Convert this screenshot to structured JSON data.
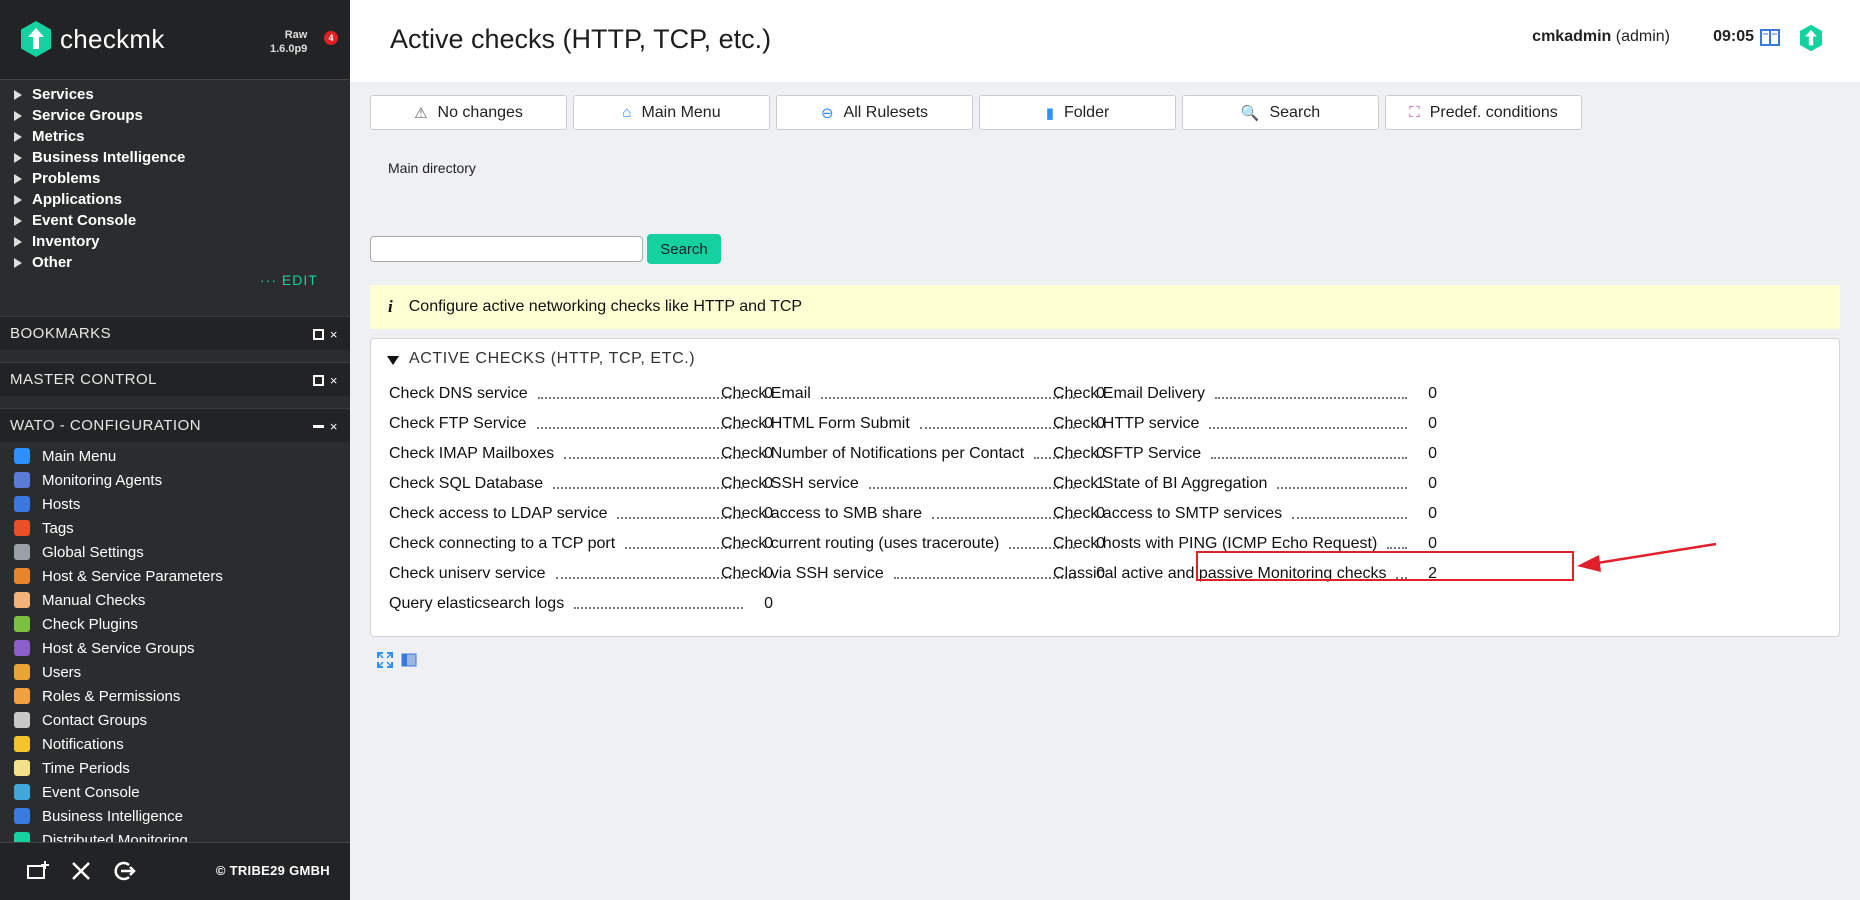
{
  "app": {
    "brand": "checkmk",
    "edition": "Raw",
    "version": "1.6.0p9",
    "werk_badge": "4",
    "copyright": "© TRIBE29 GMBH"
  },
  "colors": {
    "accent": "#15d1a0",
    "sidebar_bg": "#2a2d2e",
    "highlight": "#e0202a",
    "info_bg": "#ffffd4"
  },
  "sidebar": {
    "views": [
      {
        "label": "Services"
      },
      {
        "label": "Service Groups"
      },
      {
        "label": "Metrics"
      },
      {
        "label": "Business Intelligence"
      },
      {
        "label": "Problems"
      },
      {
        "label": "Applications"
      },
      {
        "label": "Event Console"
      },
      {
        "label": "Inventory"
      },
      {
        "label": "Other"
      }
    ],
    "edit_label": "EDIT",
    "edit_dots": "···",
    "bookmarks_title": "BOOKMARKS",
    "master_control_title": "MASTER CONTROL",
    "wato_title": "WATO - CONFIGURATION",
    "close_glyph": "×",
    "wato_items": [
      {
        "label": "Main Menu",
        "icon": "main-menu-icon",
        "color": "#2f8fff"
      },
      {
        "label": "Monitoring Agents",
        "icon": "agents-icon",
        "color": "#5a7bd6"
      },
      {
        "label": "Hosts",
        "icon": "hosts-icon",
        "color": "#3a78e0"
      },
      {
        "label": "Tags",
        "icon": "tags-icon",
        "color": "#e8502a"
      },
      {
        "label": "Global Settings",
        "icon": "settings-icon",
        "color": "#9aa0a8"
      },
      {
        "label": "Host & Service Parameters",
        "icon": "parameters-icon",
        "color": "#e8842a"
      },
      {
        "label": "Manual Checks",
        "icon": "manual-checks-icon",
        "color": "#f2b37a"
      },
      {
        "label": "Check Plugins",
        "icon": "plugins-icon",
        "color": "#7bc043"
      },
      {
        "label": "Host & Service Groups",
        "icon": "groups-icon",
        "color": "#8a5fc9"
      },
      {
        "label": "Users",
        "icon": "users-icon",
        "color": "#e8a33a"
      },
      {
        "label": "Roles & Permissions",
        "icon": "roles-icon",
        "color": "#f0a040"
      },
      {
        "label": "Contact Groups",
        "icon": "contact-groups-icon",
        "color": "#c8c8c8"
      },
      {
        "label": "Notifications",
        "icon": "bell-icon",
        "color": "#f4c430"
      },
      {
        "label": "Time Periods",
        "icon": "clock-icon",
        "color": "#f4e08a"
      },
      {
        "label": "Event Console",
        "icon": "event-console-icon",
        "color": "#40a8d8"
      },
      {
        "label": "Business Intelligence",
        "icon": "bi-icon",
        "color": "#3a7be0"
      },
      {
        "label": "Distributed Monitoring",
        "icon": "distributed-icon",
        "color": "#15d1a0"
      }
    ]
  },
  "header": {
    "title": "Active checks (HTTP, TCP, etc.)",
    "user": "cmkadmin",
    "role": "(admin)",
    "time": "09:05"
  },
  "toolbar": {
    "buttons": [
      {
        "label": "No changes",
        "icon": "warning-icon",
        "glyph": "⚠"
      },
      {
        "label": "Main Menu",
        "icon": "main-menu-icon",
        "glyph": "⌂"
      },
      {
        "label": "All Rulesets",
        "icon": "back-icon",
        "glyph": "⊖"
      },
      {
        "label": "Folder",
        "icon": "folder-icon",
        "glyph": "▮"
      },
      {
        "label": "Search",
        "icon": "search-icon",
        "glyph": "🔍"
      },
      {
        "label": "Predef. conditions",
        "icon": "conditions-icon",
        "glyph": "⛶"
      }
    ]
  },
  "breadcrumb": "Main directory",
  "search": {
    "value": "",
    "button_label": "Search"
  },
  "info": {
    "glyph": "i",
    "text": "Configure active networking checks like HTTP and TCP"
  },
  "panel": {
    "title": "ACTIVE CHECKS (HTTP, TCP, ETC.)",
    "columns": [
      [
        {
          "label": "Check DNS service",
          "count": "0"
        },
        {
          "label": "Check FTP Service",
          "count": "0"
        },
        {
          "label": "Check IMAP Mailboxes",
          "count": "0"
        },
        {
          "label": "Check SQL Database",
          "count": "0"
        },
        {
          "label": "Check access to LDAP service",
          "count": "0"
        },
        {
          "label": "Check connecting to a TCP port",
          "count": "0"
        },
        {
          "label": "Check uniserv service",
          "count": "0"
        },
        {
          "label": "Query elasticsearch logs",
          "count": "0"
        }
      ],
      [
        {
          "label": "Check Email",
          "count": "0"
        },
        {
          "label": "Check HTML Form Submit",
          "count": "0"
        },
        {
          "label": "Check Number of Notifications per Contact",
          "count": "0"
        },
        {
          "label": "Check SSH service",
          "count": "1"
        },
        {
          "label": "Check access to SMB share",
          "count": "0"
        },
        {
          "label": "Check current routing (uses traceroute)",
          "count": "0"
        },
        {
          "label": "Check via SSH service",
          "count": "0"
        }
      ],
      [
        {
          "label": "Check Email Delivery",
          "count": "0"
        },
        {
          "label": "Check HTTP service",
          "count": "0"
        },
        {
          "label": "Check SFTP Service",
          "count": "0"
        },
        {
          "label": "Check State of BI Aggregation",
          "count": "0"
        },
        {
          "label": "Check access to SMTP services",
          "count": "0"
        },
        {
          "label": "Check hosts with PING (ICMP Echo Request)",
          "count": "0"
        },
        {
          "label": "Classical active and passive Monitoring checks",
          "count": "2"
        }
      ]
    ]
  }
}
